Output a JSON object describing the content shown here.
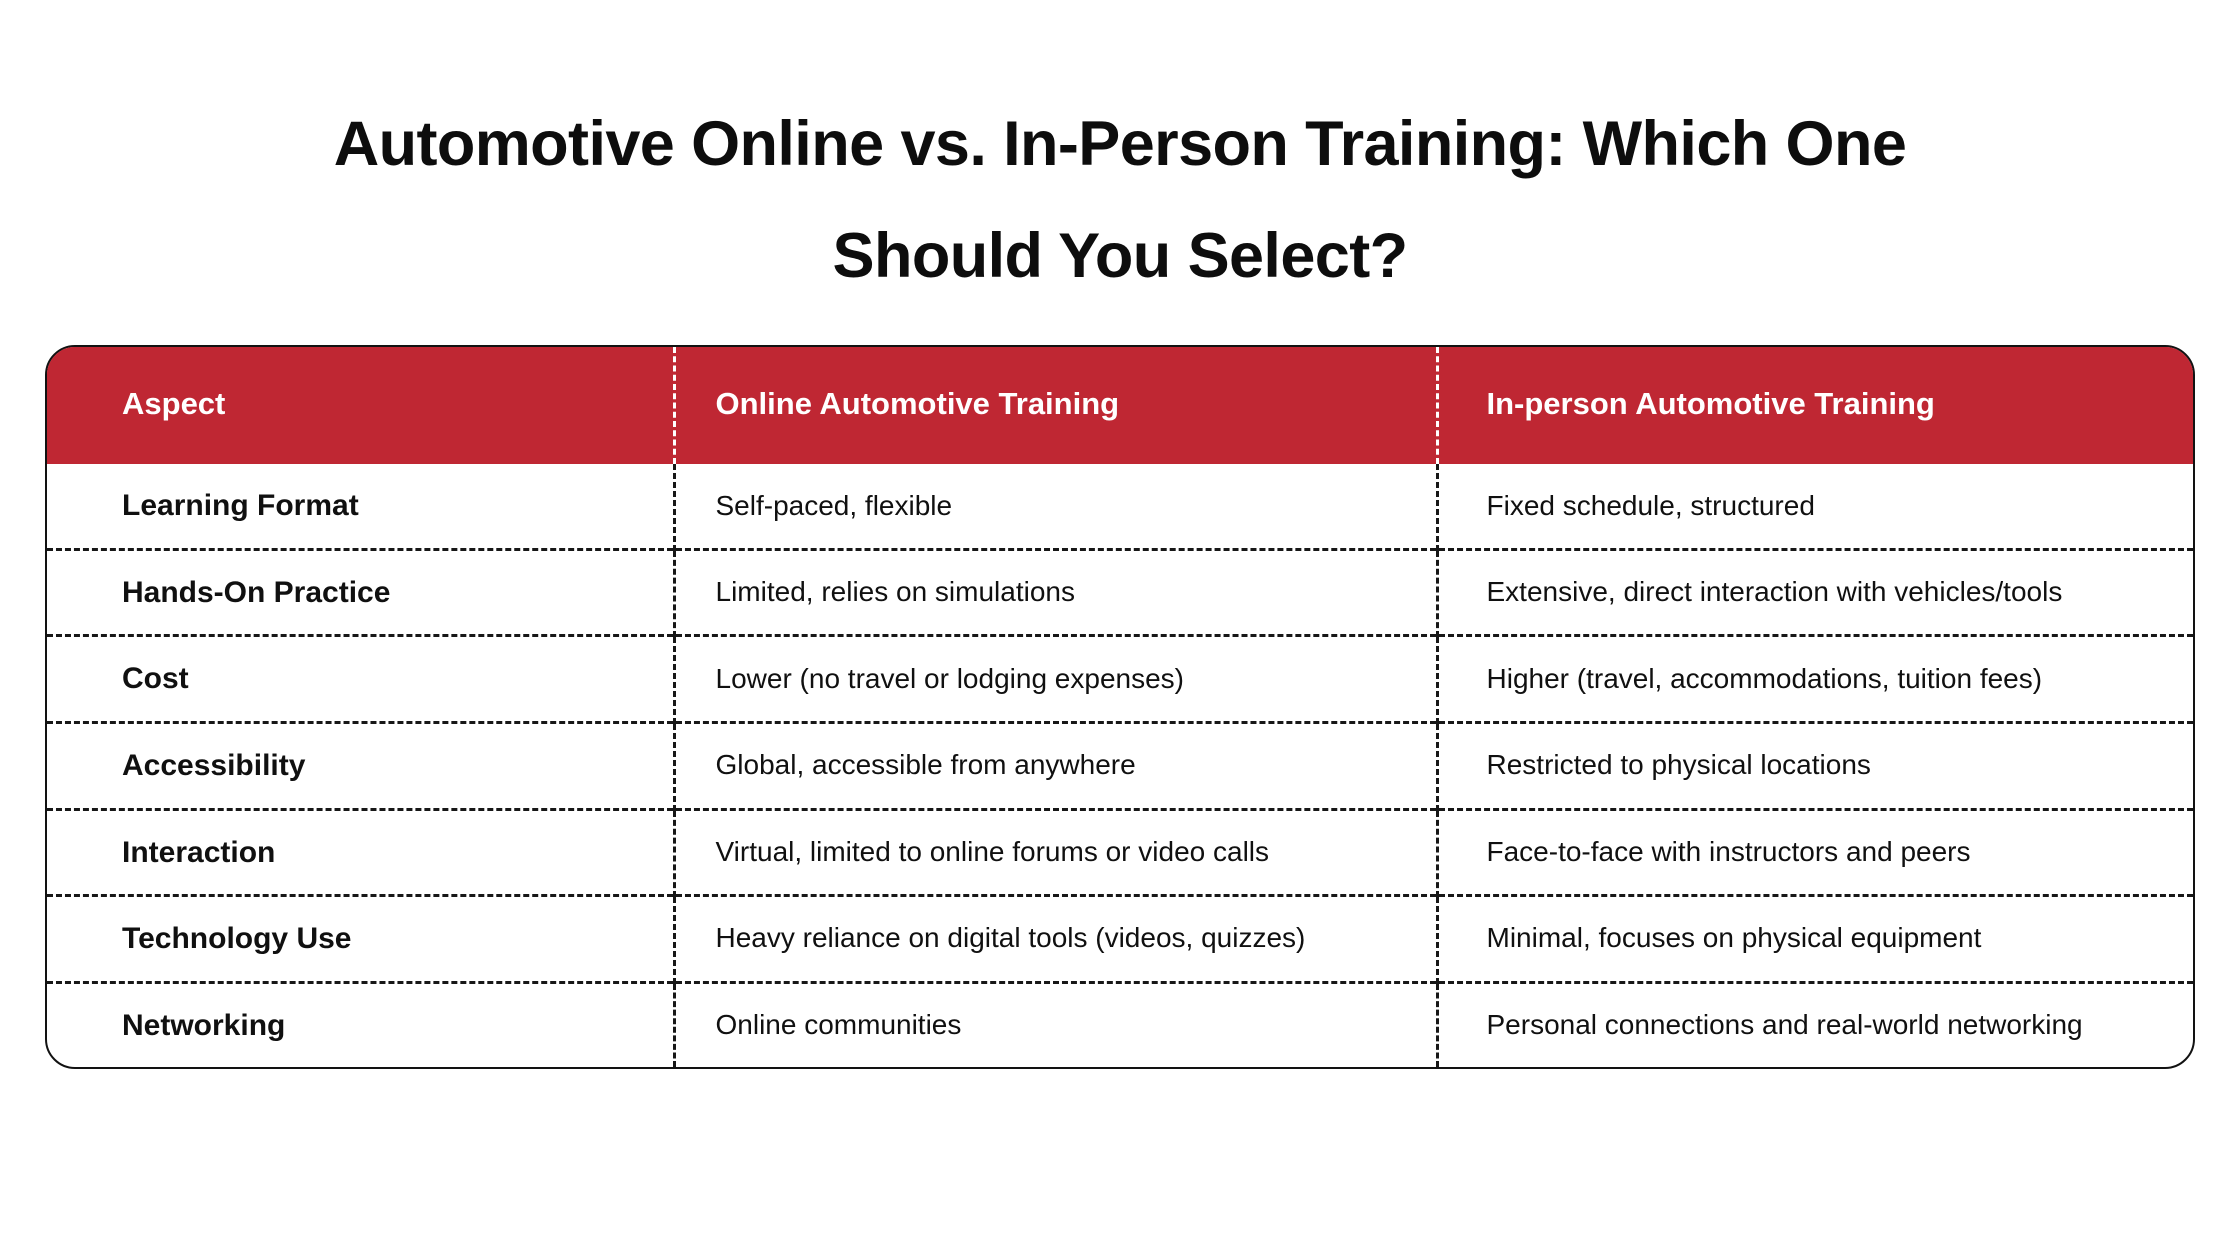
{
  "page": {
    "background_color": "#ffffff",
    "accent_color": "#bf2733",
    "text_color": "#101010"
  },
  "title": {
    "line1": "Automotive Online vs. In-Person Training: Which One",
    "line2": "Should You Select?",
    "full": "Automotive Online vs. In-Person Training: Which One Should You Select?"
  },
  "table": {
    "headers": [
      "Aspect",
      "Online Automotive Training",
      "In-person Automotive Training"
    ],
    "rows": [
      {
        "aspect": "Learning Format",
        "online": "Self-paced, flexible",
        "inperson": "Fixed schedule, structured"
      },
      {
        "aspect": "Hands-On Practice",
        "online": "Limited, relies on simulations",
        "inperson": "Extensive, direct interaction with vehicles/tools"
      },
      {
        "aspect": "Cost",
        "online": "Lower (no travel or lodging expenses)",
        "inperson": "Higher (travel, accommodations, tuition fees)"
      },
      {
        "aspect": "Accessibility",
        "online": "Global, accessible from anywhere",
        "inperson": "Restricted to physical locations"
      },
      {
        "aspect": "Interaction",
        "online": "Virtual, limited to online forums or video calls",
        "inperson": "Face-to-face with instructors and peers"
      },
      {
        "aspect": "Technology Use",
        "online": "Heavy reliance on digital tools (videos, quizzes)",
        "inperson": "Minimal, focuses on physical equipment"
      },
      {
        "aspect": "Networking",
        "online": "Online communities",
        "inperson": "Personal connections and real-world networking"
      }
    ]
  }
}
